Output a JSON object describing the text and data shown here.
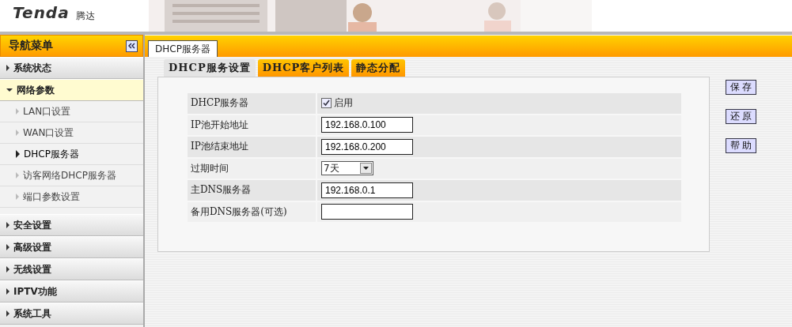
{
  "header": {
    "logo": "Tenda",
    "logo_cn": "腾达"
  },
  "sidebar": {
    "title": "导航菜单",
    "items": [
      {
        "label": "系统状态",
        "expanded": false
      },
      {
        "label": "网络参数",
        "expanded": true,
        "children": [
          {
            "label": "LAN口设置",
            "selected": false
          },
          {
            "label": "WAN口设置",
            "selected": false
          },
          {
            "label": "DHCP服务器",
            "selected": true
          },
          {
            "label": "访客网络DHCP服务器",
            "selected": false
          },
          {
            "label": "端口参数设置",
            "selected": false
          }
        ]
      },
      {
        "label": "安全设置",
        "expanded": false
      },
      {
        "label": "高级设置",
        "expanded": false
      },
      {
        "label": "无线设置",
        "expanded": false
      },
      {
        "label": "IPTV功能",
        "expanded": false
      },
      {
        "label": "系统工具",
        "expanded": false
      }
    ]
  },
  "page_tab": "DHCP服务器",
  "tabs": [
    {
      "label": "DHCP服务设置",
      "selected": true
    },
    {
      "label": "DHCP客户列表",
      "selected": false
    },
    {
      "label": "静态分配",
      "selected": false
    }
  ],
  "form": [
    {
      "kind": "checkbox",
      "label": "DHCP服务器",
      "checked": true,
      "text": "启用"
    },
    {
      "kind": "text",
      "label": "IP池开始地址",
      "value": "192.168.0.100"
    },
    {
      "kind": "text",
      "label": "IP池结束地址",
      "value": "192.168.0.200"
    },
    {
      "kind": "select",
      "label": "过期时间",
      "value": "7天"
    },
    {
      "kind": "text",
      "label": "主DNS服务器",
      "value": "192.168.0.1"
    },
    {
      "kind": "text",
      "label": "备用DNS服务器(可选)"
    }
  ],
  "buttons": [
    "保存",
    "还原",
    "帮助"
  ]
}
